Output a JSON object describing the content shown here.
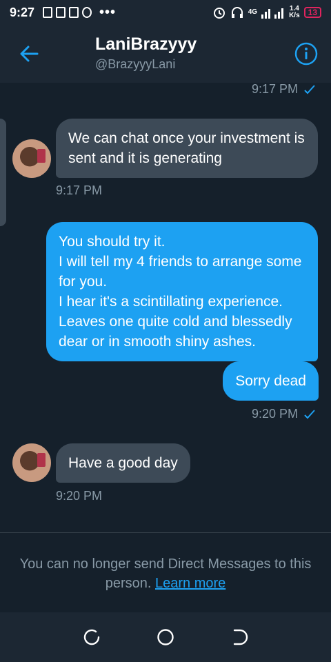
{
  "status_bar": {
    "time": "9:27",
    "dots": "•••",
    "network_type": "4G",
    "speed_value": "1.4",
    "speed_unit": "K/s",
    "battery": "13"
  },
  "header": {
    "title": "LaniBrazyyy",
    "handle": "@BrazyyyLani"
  },
  "messages": [
    {
      "side": "out-ts",
      "time": "9:17 PM"
    },
    {
      "side": "in",
      "text": "We can chat once your investment is sent and it is generating",
      "time": "9:17 PM"
    },
    {
      "side": "out",
      "text": "You should try it.\nI will tell my 4 friends to arrange some for you.\nI hear it's a scintillating experience.\nLeaves one quite cold and blessedly dear or in smooth shiny ashes."
    },
    {
      "side": "out",
      "text": "Sorry dead",
      "time": "9:20 PM"
    },
    {
      "side": "in",
      "text": "Have a good day",
      "time": "9:20 PM"
    }
  ],
  "notice": {
    "text": "You can no longer send Direct Messages to this person.",
    "link": "Learn more"
  },
  "colors": {
    "background": "#15202b",
    "accent": "#1da1f2",
    "incoming_bubble": "#3d4a57",
    "muted_text": "#8899a6"
  }
}
